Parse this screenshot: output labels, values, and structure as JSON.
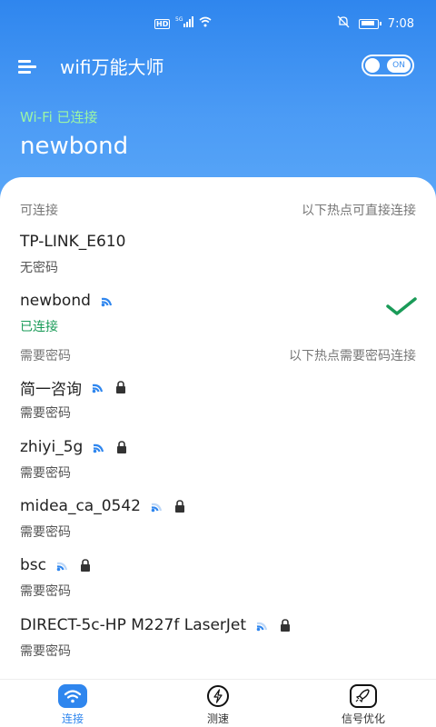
{
  "status_bar": {
    "time": "7:08",
    "network": "5G",
    "hd": "HD"
  },
  "app": {
    "title": "wifi万能大师",
    "toggle_label": "ON"
  },
  "connection": {
    "status": "Wi-Fi 已连接",
    "ssid": "newbond"
  },
  "section_open": {
    "title": "可连接",
    "hint": "以下热点可直接连接"
  },
  "open_networks": [
    {
      "name": "TP-LINK_E610",
      "sub": "无密码"
    },
    {
      "name": "newbond",
      "sub": "已连接"
    }
  ],
  "section_secured": {
    "title": "需要密码",
    "hint": "以下热点需要密码连接"
  },
  "secured_networks": [
    {
      "name": "简一咨询",
      "sub": "需要密码"
    },
    {
      "name": "zhiyi_5g",
      "sub": "需要密码"
    },
    {
      "name": "midea_ca_0542",
      "sub": "需要密码"
    },
    {
      "name": "bsc",
      "sub": "需要密码"
    },
    {
      "name": "DIRECT-5c-HP M227f LaserJet",
      "sub": "需要密码"
    }
  ],
  "bottom_nav": [
    {
      "label": "连接",
      "icon": "wifi-icon",
      "active": true
    },
    {
      "label": "测速",
      "icon": "lightning-icon",
      "active": false
    },
    {
      "label": "信号优化",
      "icon": "rocket-icon",
      "active": false
    }
  ],
  "colors": {
    "accent": "#2f86ee",
    "connected_green": "#1a9b58",
    "status_green": "#9bf5a6"
  }
}
